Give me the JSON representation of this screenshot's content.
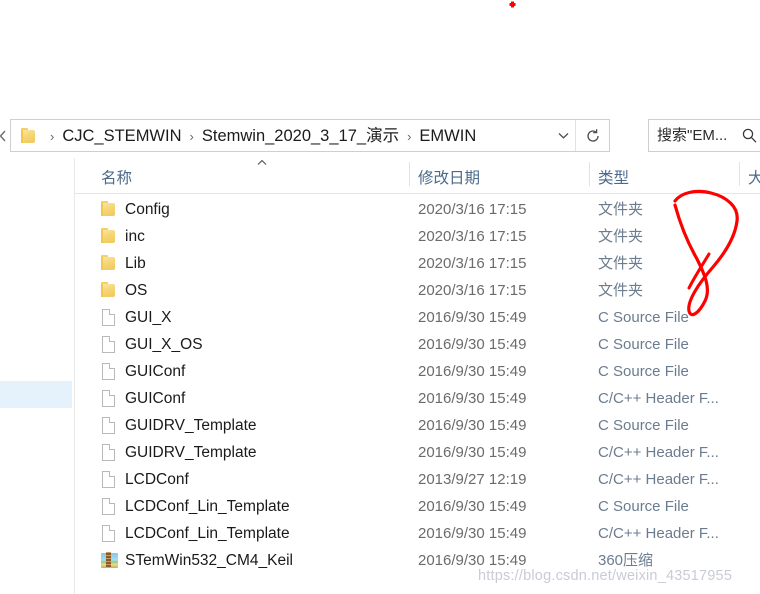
{
  "window": {
    "nav": {
      "back_icon": "chevron-left-icon"
    }
  },
  "address_bar": {
    "folder_icon": "folder-icon",
    "crumbs": [
      "CJC_STEMWIN",
      "Stemwin_2020_3_17_演示",
      "EMWIN"
    ],
    "separator": "›",
    "dropdown_icon": "chevron-down-icon",
    "refresh_icon": "refresh-icon"
  },
  "search": {
    "value": "搜索\"EM...",
    "icon": "search-icon"
  },
  "columns": {
    "name": "名称",
    "date_modified": "修改日期",
    "type": "类型",
    "size": "大",
    "sort_indicator": "caret-up-icon"
  },
  "files": [
    {
      "name": "Config",
      "date": "2020/3/16 17:15",
      "type": "文件夹",
      "icon": "folder-icon"
    },
    {
      "name": "inc",
      "date": "2020/3/16 17:15",
      "type": "文件夹",
      "icon": "folder-icon"
    },
    {
      "name": "Lib",
      "date": "2020/3/16 17:15",
      "type": "文件夹",
      "icon": "folder-icon"
    },
    {
      "name": "OS",
      "date": "2020/3/16 17:15",
      "type": "文件夹",
      "icon": "folder-icon"
    },
    {
      "name": "GUI_X",
      "date": "2016/9/30 15:49",
      "type": "C Source File",
      "icon": "document-icon"
    },
    {
      "name": "GUI_X_OS",
      "date": "2016/9/30 15:49",
      "type": "C Source File",
      "icon": "document-icon"
    },
    {
      "name": "GUIConf",
      "date": "2016/9/30 15:49",
      "type": "C Source File",
      "icon": "document-icon"
    },
    {
      "name": "GUIConf",
      "date": "2016/9/30 15:49",
      "type": "C/C++ Header F...",
      "icon": "document-icon"
    },
    {
      "name": "GUIDRV_Template",
      "date": "2016/9/30 15:49",
      "type": "C Source File",
      "icon": "document-icon"
    },
    {
      "name": "GUIDRV_Template",
      "date": "2016/9/30 15:49",
      "type": "C/C++ Header F...",
      "icon": "document-icon"
    },
    {
      "name": "LCDConf",
      "date": "2013/9/27 12:19",
      "type": "C/C++ Header F...",
      "icon": "document-icon"
    },
    {
      "name": "LCDConf_Lin_Template",
      "date": "2016/9/30 15:49",
      "type": "C Source File",
      "icon": "document-icon"
    },
    {
      "name": "LCDConf_Lin_Template",
      "date": "2016/9/30 15:49",
      "type": "C/C++ Header F...",
      "icon": "document-icon"
    },
    {
      "name": "STemWin532_CM4_Keil",
      "date": "2016/9/30 15:49",
      "type": "360压缩",
      "icon": "archive-icon"
    }
  ],
  "annotation": {
    "color": "#fe0000",
    "shape": "hand-drawn-loop"
  },
  "watermark": {
    "text": "https://blog.csdn.net/weixin_43517955"
  }
}
